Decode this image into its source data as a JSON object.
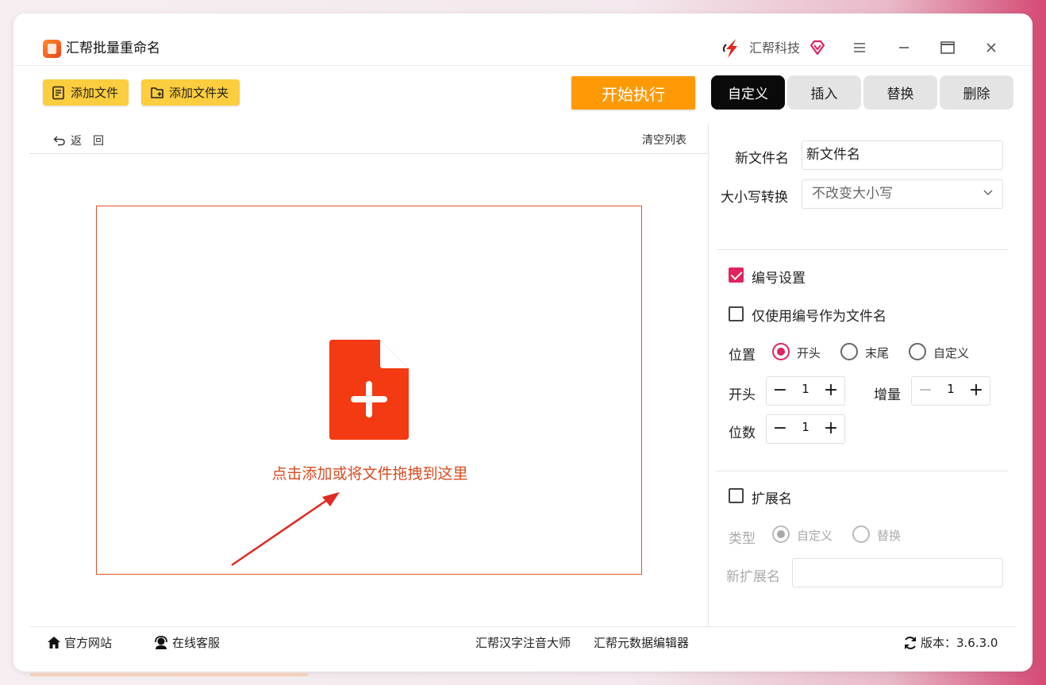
{
  "app": {
    "title": "汇帮批量重命名"
  },
  "brand": {
    "name": "汇帮科技"
  },
  "toolbar": {
    "add_file": "添加文件",
    "add_folder": "添加文件夹",
    "start": "开始执行"
  },
  "tabs": [
    {
      "label": "自定义",
      "active": true
    },
    {
      "label": "插入",
      "active": false
    },
    {
      "label": "替换",
      "active": false
    },
    {
      "label": "删除",
      "active": false
    }
  ],
  "list": {
    "back": "返回",
    "clear": "清空列表",
    "drop_hint": "点击添加或将文件拖拽到这里"
  },
  "settings": {
    "new_name_label": "新文件名",
    "new_name_value": "新文件名",
    "case_label": "大小写转换",
    "case_value": "不改变大小写",
    "numbering_label": "编号设置",
    "numbering_checked": true,
    "only_number_label": "仅使用编号作为文件名",
    "only_number_checked": false,
    "position_label": "位置",
    "position_options": [
      "开头",
      "末尾",
      "自定义"
    ],
    "position_selected": "开头",
    "start_label": "开头",
    "start_value": "1",
    "increment_label": "增量",
    "increment_value": "1",
    "digits_label": "位数",
    "digits_value": "1",
    "ext_label": "扩展名",
    "ext_checked": false,
    "type_label": "类型",
    "type_options": [
      "自定义",
      "替换"
    ],
    "type_selected": "自定义",
    "new_ext_label": "新扩展名",
    "new_ext_value": ""
  },
  "footer": {
    "website": "官方网站",
    "support": "在线客服",
    "product1": "汇帮汉字注音大师",
    "product2": "汇帮元数据编辑器",
    "version": "版本：3.6.3.0"
  },
  "colors": {
    "accent": "#e0245e",
    "toolbar_button": "#fccd3e",
    "start_button": "#ff9a06",
    "drop_border": "#e0542a",
    "drop_icon": "#f33a12"
  }
}
